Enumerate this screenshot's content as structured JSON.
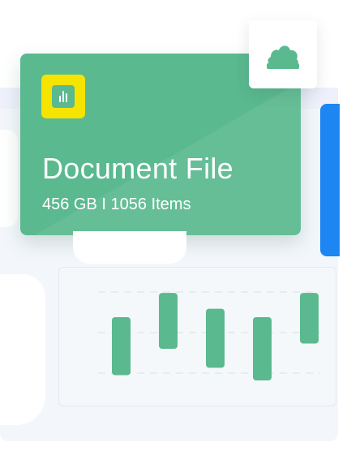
{
  "document_card": {
    "title": "Document File",
    "subtitle": "456 GB I 1056 Items",
    "badge_icon": "bar-chart-icon",
    "card_color": "#5ab98e",
    "badge_color": "#f5e300"
  },
  "upload_tile": {
    "icon": "cloud-upload-icon",
    "icon_color": "#5ab98e"
  },
  "accent": {
    "blue": "#1e86f2"
  },
  "chart_data": {
    "type": "bar",
    "bar_color": "#5ab98e",
    "grid": true,
    "series": [
      {
        "ranges": [
          [
            0.15,
            0.7
          ],
          [
            0.4,
            0.93
          ],
          [
            0.22,
            0.78
          ],
          [
            0.1,
            0.7
          ],
          [
            0.45,
            0.93
          ]
        ]
      }
    ]
  }
}
